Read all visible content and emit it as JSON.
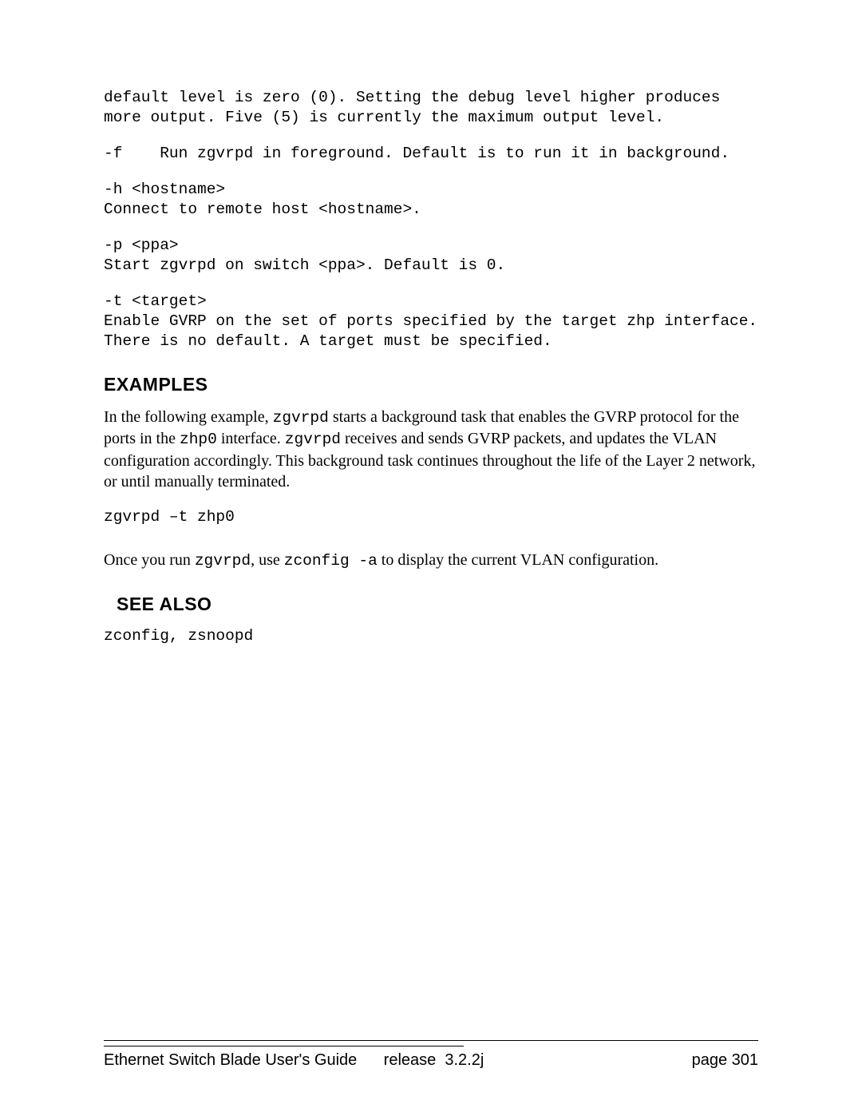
{
  "options": {
    "intro": "default level is zero (0). Setting the debug level higher produces more output. Five (5) is currently the maximum output level.",
    "f": "-f    Run zgvrpd in foreground. Default is to run it in background.",
    "h": "-h <hostname>\nConnect to remote host <hostname>.",
    "p": "-p <ppa>\nStart zgvrpd on switch <ppa>. Default is 0.",
    "t": "-t <target>\nEnable GVRP on the set of ports specified by the target zhp interface. There is no default. A target must be specified."
  },
  "headings": {
    "examples": "EXAMPLES",
    "see_also": "SEE ALSO"
  },
  "examples": {
    "p1_a": "In the following example, ",
    "p1_cmd1": "zgvrpd",
    "p1_b": " starts a background task that enables the GVRP protocol for the ports in the ",
    "p1_iface": "zhp0",
    "p1_c": " interface.  ",
    "p1_cmd2": "zgvrpd",
    "p1_d": " receives and sends GVRP packets, and updates the VLAN configuration accordingly. This background task continues throughout the life of the Layer 2 network, or until manually terminated.",
    "cmd": "zgvrpd –t zhp0",
    "p2_a": "Once you run ",
    "p2_cmd1": "zgvrpd",
    "p2_b": ", use ",
    "p2_cmd2": "zconfig -a",
    "p2_c": " to display the current VLAN configuration."
  },
  "see_also": "zconfig, zsnoopd",
  "footer": {
    "title": "Ethernet Switch Blade User's Guide",
    "release": "release  3.2.2j",
    "page": "page  301"
  }
}
